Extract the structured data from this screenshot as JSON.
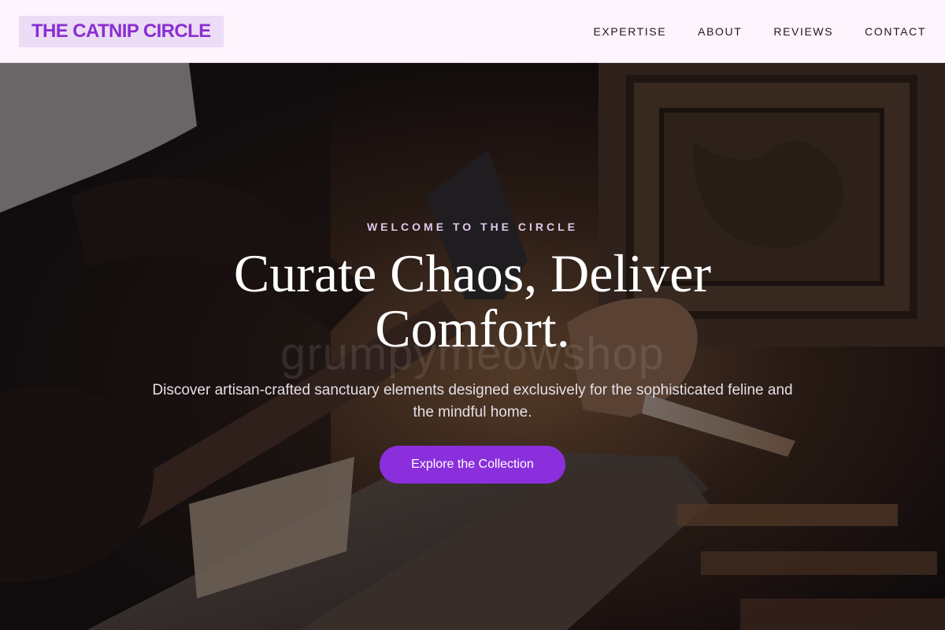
{
  "nav": {
    "logo": "THE CATNIP CIRCLE",
    "links": [
      {
        "label": "EXPERTISE"
      },
      {
        "label": "ABOUT"
      },
      {
        "label": "REVIEWS"
      },
      {
        "label": "CONTACT"
      }
    ]
  },
  "hero": {
    "eyebrow": "WELCOME TO THE CIRCLE",
    "headline": "Curate Chaos, Deliver Comfort.",
    "watermark": "grumpymeowshop",
    "subtext": "Discover artisan-crafted sanctuary elements designed exclusively for the sophisticated feline and the mindful home.",
    "cta_label": "Explore the Collection",
    "background_icon": "woodworking-photo"
  },
  "colors": {
    "nav_background": "#fdf4fd",
    "brand_accent": "#8b2fdd",
    "logo_background": "#ecdcf6",
    "eyebrow": "#e0c8ec"
  }
}
